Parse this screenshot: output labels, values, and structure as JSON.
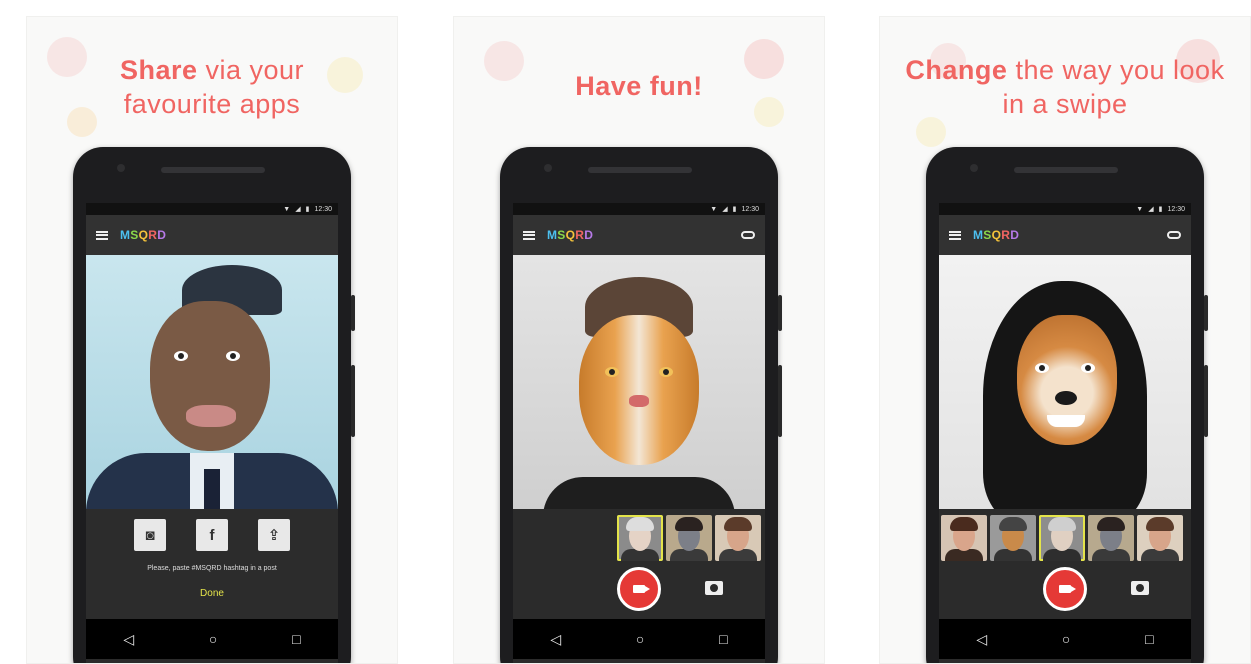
{
  "colors": {
    "accent": "#f06562",
    "record": "#e53936",
    "done": "#e4e44a"
  },
  "panels": [
    {
      "caption_bold": "Share",
      "caption_rest1": "via your",
      "caption_line2": "favourite apps",
      "status_time": "12:30",
      "share_hint": "Please, paste #MSQRD hashtag in a post",
      "done_label": "Done",
      "share_icons": [
        "instagram-icon",
        "facebook-icon",
        "share-icon"
      ]
    },
    {
      "caption_bold": "Have fun!",
      "status_time": "12:30"
    },
    {
      "caption_bold": "Change",
      "caption_rest1": "the way you look",
      "caption_line2": "in a swipe",
      "status_time": "12:30"
    }
  ],
  "app_logo": {
    "m": "M",
    "s": "S",
    "q": "Q",
    "r": "R",
    "d": "D"
  },
  "share_glyphs": {
    "instagram": "◙",
    "facebook": "f",
    "share": "⇪"
  },
  "nav": {
    "back": "◁",
    "home": "○",
    "recents": "□"
  }
}
